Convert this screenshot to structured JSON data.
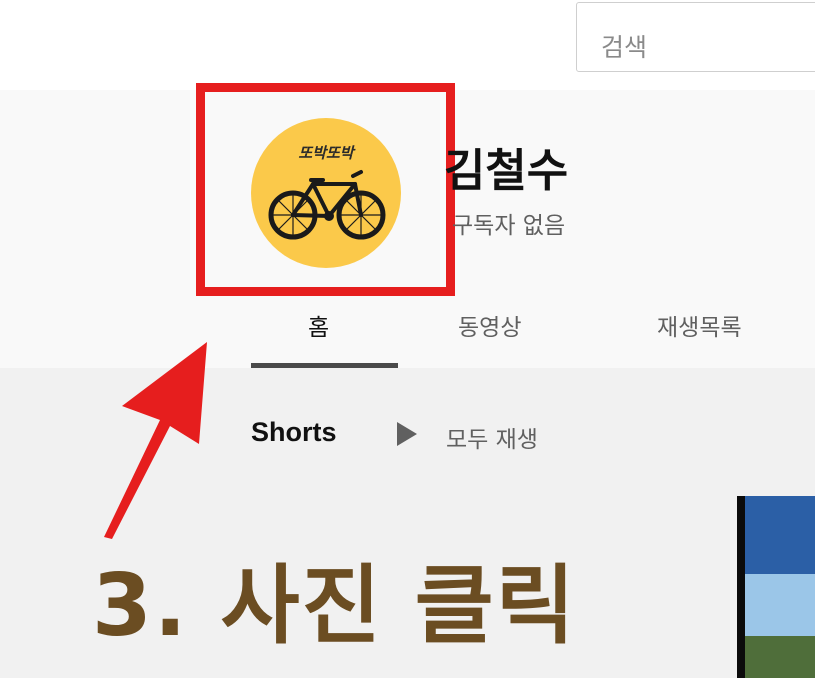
{
  "search": {
    "placeholder": "검색"
  },
  "channel": {
    "name": "김철수",
    "subscribers": "구독자 없음",
    "avatar_text": "또박또박",
    "avatar_color": "#fbc94a"
  },
  "tabs": [
    {
      "label": "홈",
      "active": true
    },
    {
      "label": "동영상",
      "active": false
    },
    {
      "label": "재생목록",
      "active": false
    }
  ],
  "shorts": {
    "title": "Shorts",
    "play_all": "모두 재생"
  },
  "annotation": {
    "instruction": "3. 사진 클릭",
    "highlight_color": "#e61e1e",
    "text_color": "#6b4d22"
  },
  "icons": [
    "bicycle-icon",
    "play-icon",
    "arrow-icon"
  ]
}
